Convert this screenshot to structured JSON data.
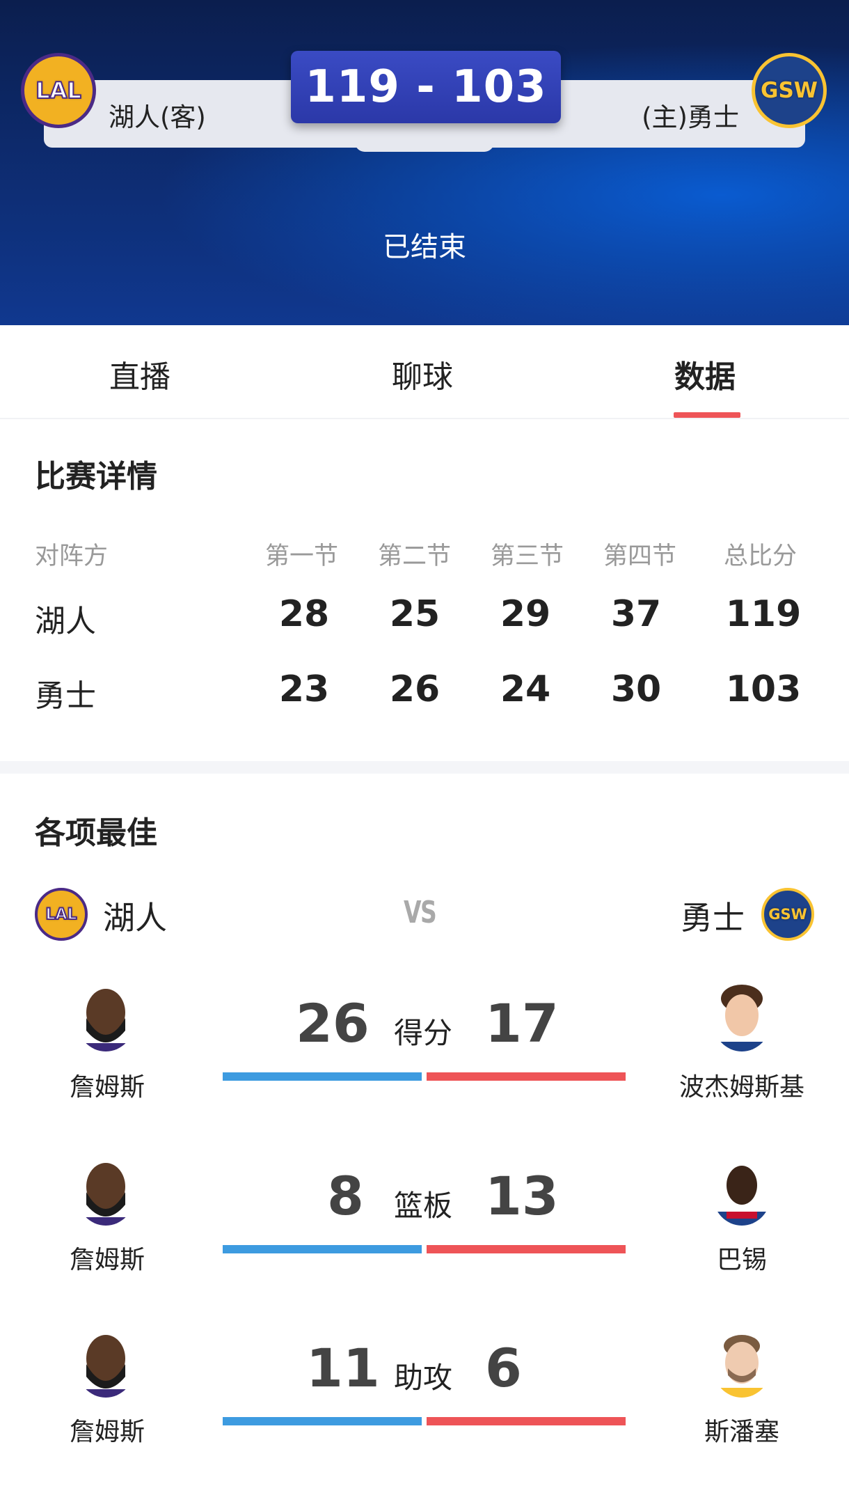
{
  "header": {
    "score": "119 - 103",
    "away_team": "湖人(客)",
    "home_team": "(主)勇士",
    "away_logo_text": "LAL",
    "home_logo_text": "GSW",
    "status": "已结束"
  },
  "tabs": [
    {
      "label": "直播"
    },
    {
      "label": "聊球"
    },
    {
      "label": "数据",
      "active": true
    }
  ],
  "game_details": {
    "title": "比赛详情",
    "headers": [
      "对阵方",
      "第一节",
      "第二节",
      "第三节",
      "第四节",
      "总比分"
    ],
    "rows": [
      {
        "team": "湖人",
        "q1": "28",
        "q2": "25",
        "q3": "29",
        "q4": "37",
        "total": "119"
      },
      {
        "team": "勇士",
        "q1": "23",
        "q2": "26",
        "q3": "24",
        "q4": "30",
        "total": "103"
      }
    ]
  },
  "leaders": {
    "title": "各项最佳",
    "left_team": "湖人",
    "right_team": "勇士",
    "vs": "VS",
    "left_logo_text": "LAL",
    "right_logo_text": "GSW",
    "stats": [
      {
        "label": "得分",
        "left_player": "詹姆斯",
        "left_value": "26",
        "right_player": "波杰姆斯基",
        "right_value": "17"
      },
      {
        "label": "篮板",
        "left_player": "詹姆斯",
        "left_value": "8",
        "right_player": "巴锡",
        "right_value": "13"
      },
      {
        "label": "助攻",
        "left_player": "詹姆斯",
        "left_value": "11",
        "right_player": "斯潘塞",
        "right_value": "6"
      }
    ]
  },
  "colors": {
    "accent_red": "#ee5457",
    "accent_blue": "#3d9be0",
    "header_dark": "#0b1e4e"
  }
}
